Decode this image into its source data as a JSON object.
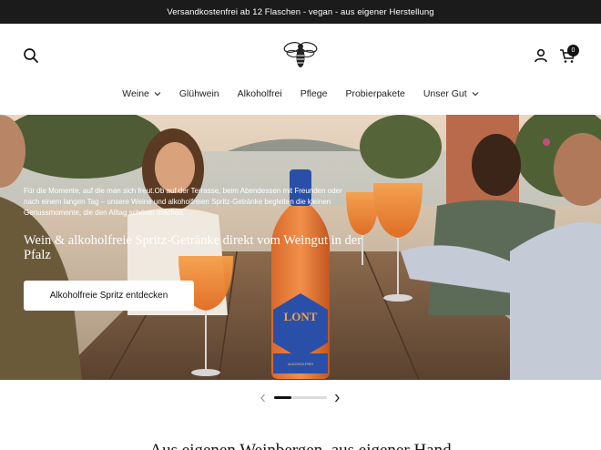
{
  "announcement": "Versandkostenfrei ab 12 Flaschen - vegan - aus eigener Herstellung",
  "header": {
    "icons": {
      "search": "search-icon",
      "logo": "bee-logo",
      "account": "user-icon",
      "cart": "cart-icon"
    },
    "cart_count": "0"
  },
  "nav": {
    "items": [
      {
        "label": "Weine",
        "dropdown": true
      },
      {
        "label": "Glühwein",
        "dropdown": false
      },
      {
        "label": "Alkoholfrei",
        "dropdown": false
      },
      {
        "label": "Pflege",
        "dropdown": false
      },
      {
        "label": "Probierpakete",
        "dropdown": false
      },
      {
        "label": "Unser Gut",
        "dropdown": true
      }
    ]
  },
  "hero": {
    "description": "Für die Momente, auf die man sich freut.Ob auf der Terrasse, beim Abendessen mit Freunden oder nach einem langen Tag – unsere Weine und alkoholfreien Spritz-Getränke begleiten die kleinen Genussmomente, die den Alltag schöner machen.",
    "title": "Wein & alkoholfreie Spritz-Getränke direkt vom Weingut in der Pfalz",
    "cta": "Alkoholfreie Spritz entdecken",
    "bottle_label": "LONT",
    "bottle_sub": "ALKOHOLFREI"
  },
  "slider": {
    "progress": 0.33
  },
  "section_heading": "Aus eigenen Weinbergen, aus eigener Hand"
}
